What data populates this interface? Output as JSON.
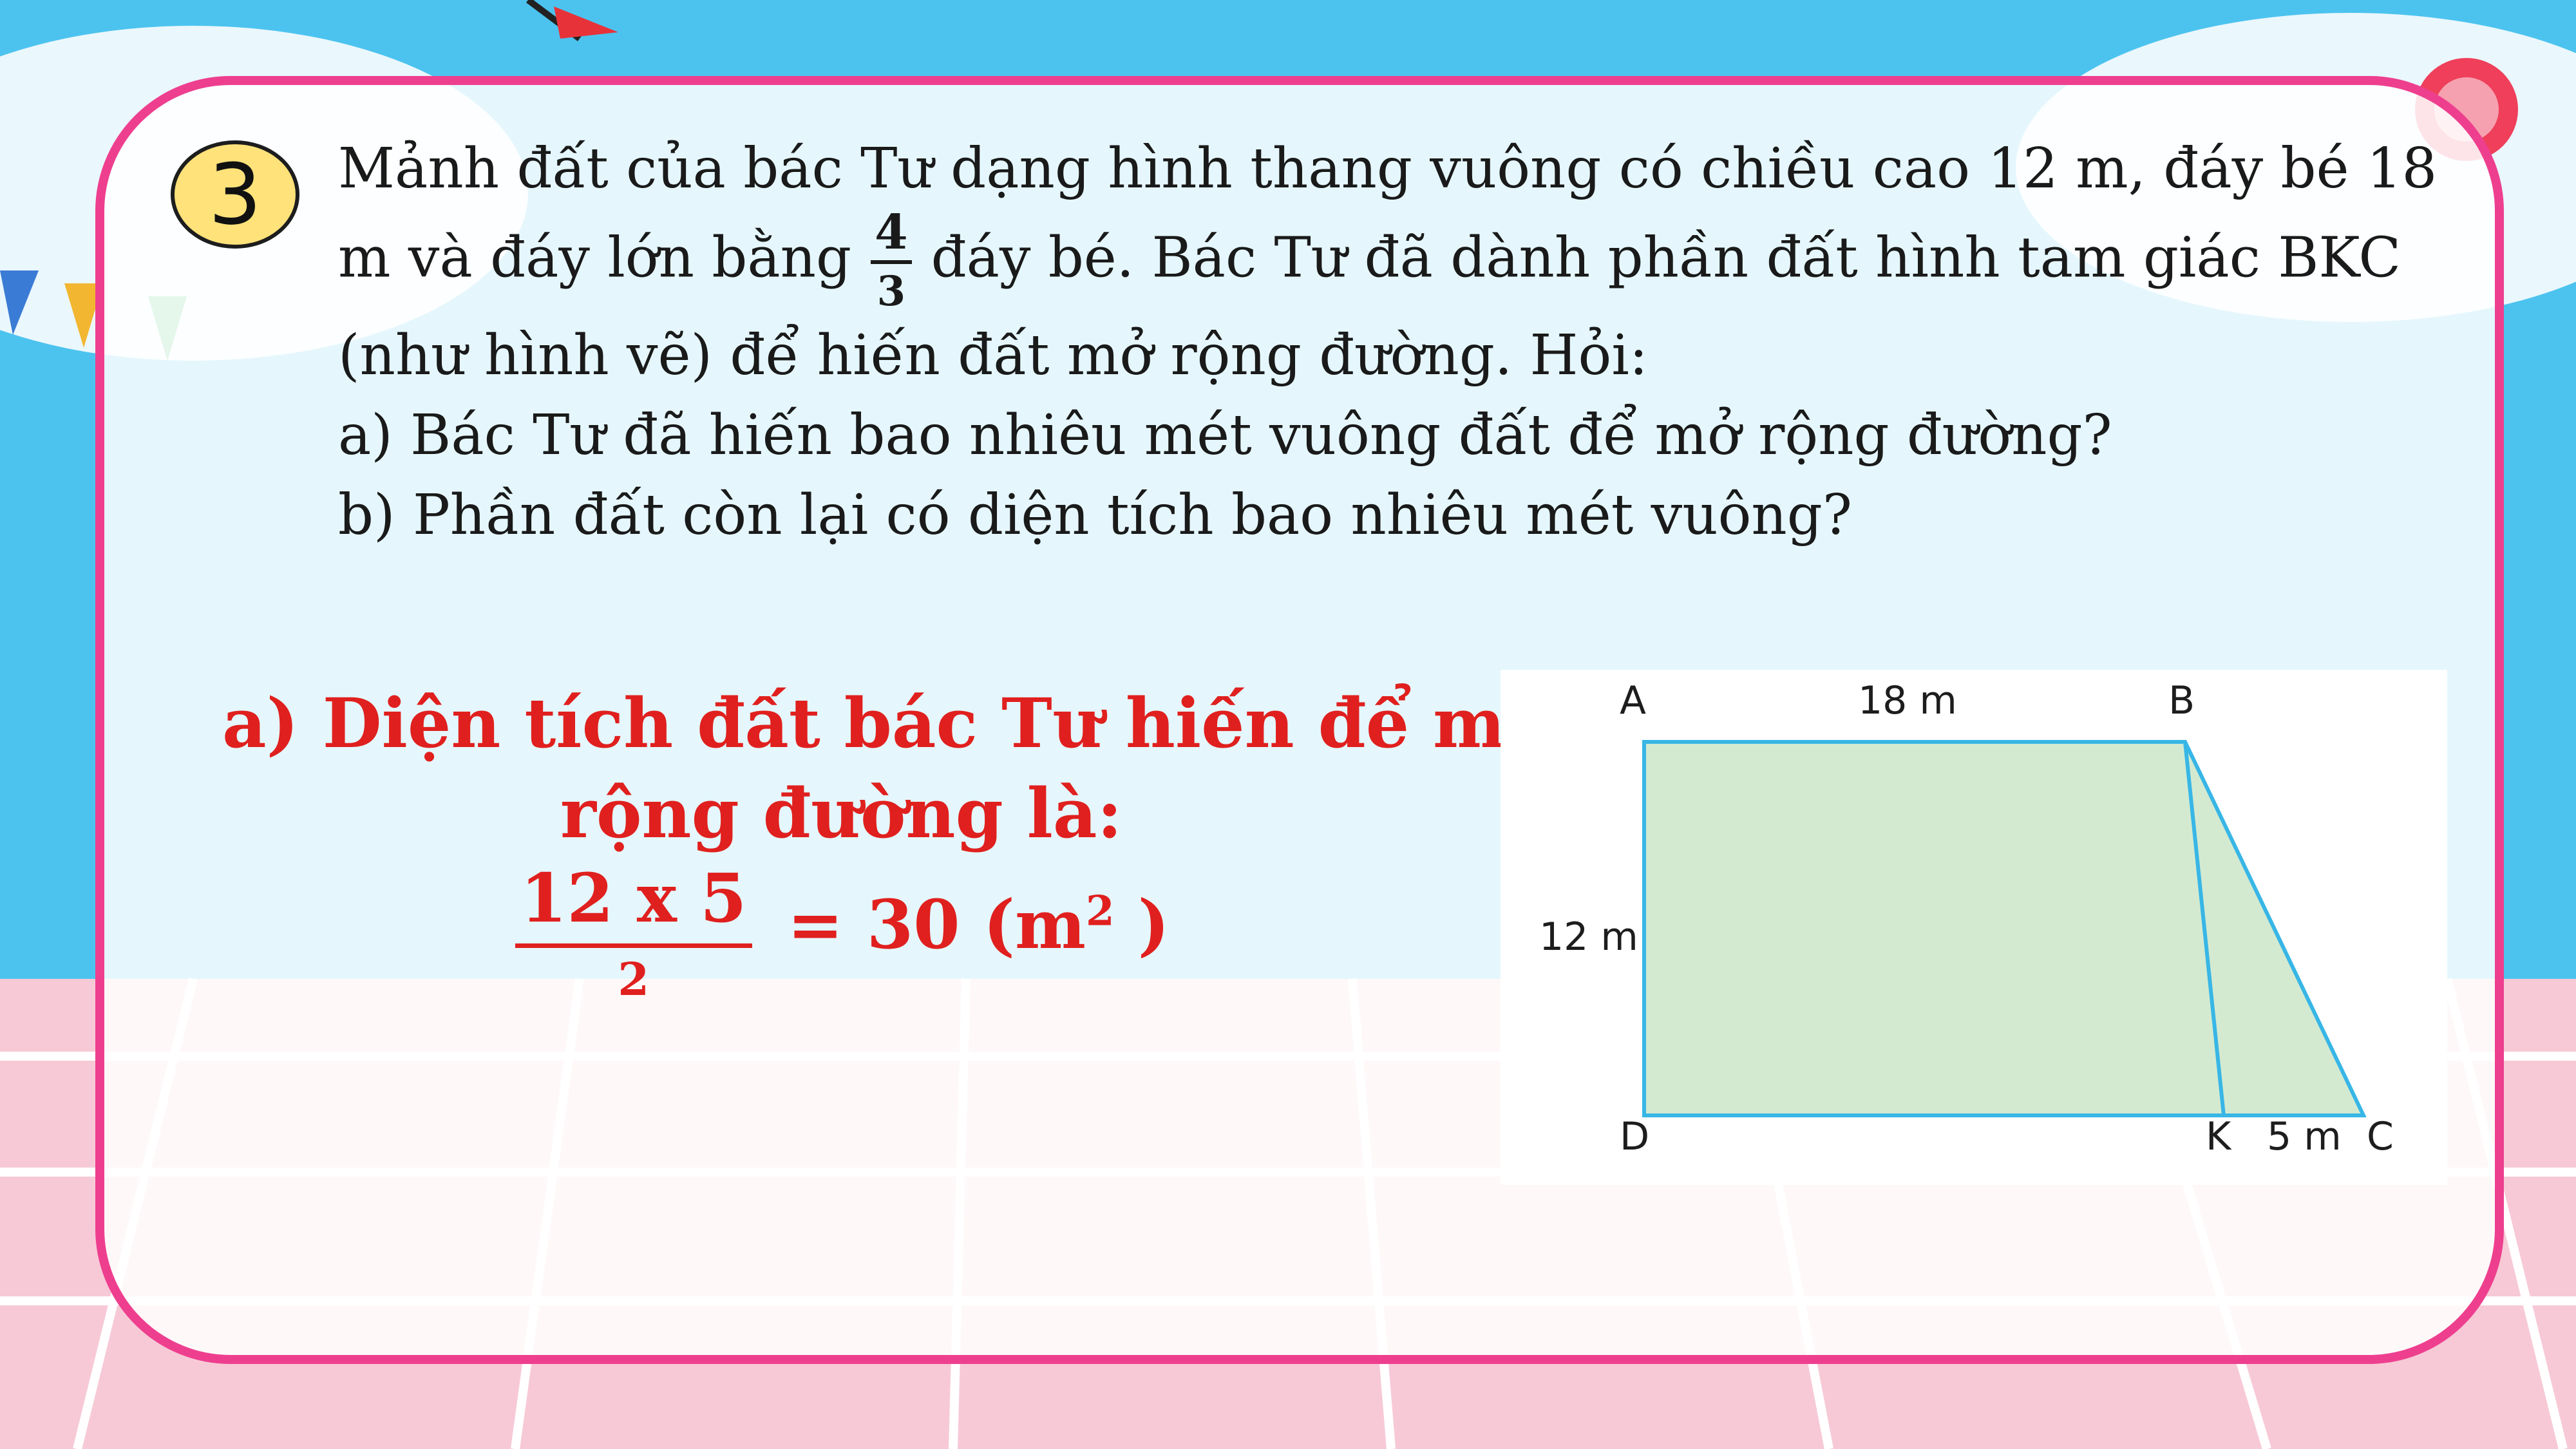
{
  "problem": {
    "number": "3",
    "line1": "Mảnh đất của bác Tư dạng hình thang vuông có chiều cao 12 m, đáy bé 18",
    "line2_before": "m và đáy lớn bằng",
    "fraction": {
      "numerator": "4",
      "denominator": "3"
    },
    "line2_after": "đáy bé. Bác Tư đã dành phần đất hình tam giác BKC",
    "line3": "(như hình vẽ) để hiến đất mở rộng đường. Hỏi:",
    "line4": "a) Bác Tư đã hiến bao nhiêu mét vuông đất để mở rộng đường?",
    "line5": "b) Phần đất còn lại có diện tích bao nhiêu mét vuông?"
  },
  "answer": {
    "line1": "a) Diện tích đất bác Tư hiến để mở",
    "line2": "rộng đường là:",
    "numerator": "12 x 5",
    "denominator": "2",
    "result_prefix": "= 30 (m",
    "result_exponent": "2",
    "result_suffix": " )"
  },
  "figure": {
    "label_A": "A",
    "label_B": "B",
    "label_C": "C",
    "label_D": "D",
    "label_K": "K",
    "top_length": "18 m",
    "height_length": "12 m",
    "kc_length": "5 m",
    "fill_color": "#d3ead1",
    "stroke_color": "#38b6e6"
  },
  "colors": {
    "border": "#ee3f8f",
    "answer": "#e0201e",
    "badge": "#ffe27a",
    "sky": "#4cc3ef"
  }
}
